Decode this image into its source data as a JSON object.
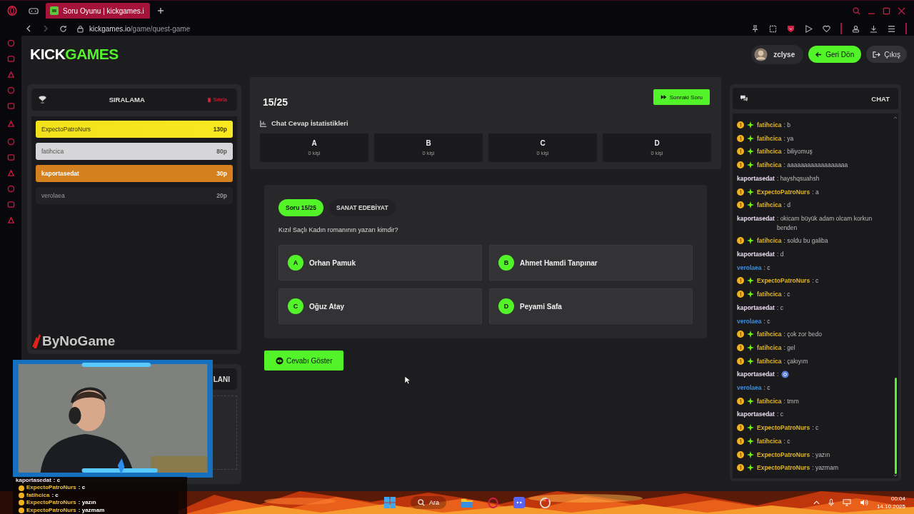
{
  "browser": {
    "tab_title": "Soru Oyunu | kickgames.i",
    "url_host": "kickgames.io",
    "url_path": "/game/quest-game"
  },
  "header": {
    "logo_first": "KICK",
    "logo_second": "GAMES",
    "user": "zclyse",
    "back_button": "Geri Dön",
    "logout_button": "Çıkış"
  },
  "leaderboard": {
    "title": "SIRALAMA",
    "reset": "Sıfırla",
    "rows": [
      {
        "name": "ExpectoPatroNurs",
        "points": "130p",
        "kind": "gold"
      },
      {
        "name": "fatihcica",
        "points": "80p",
        "kind": "silver"
      },
      {
        "name": "kaportasedat",
        "points": "30p",
        "kind": "bronze"
      },
      {
        "name": "verolaea",
        "points": "20p",
        "kind": "plain"
      }
    ]
  },
  "overlay_logo": "ByNoGame",
  "second_panel": {
    "title": "LANI"
  },
  "game": {
    "counter": "15/25",
    "next_button": "Sonraki Soru",
    "stats_title": "Chat Cevap İstatistikleri",
    "stats": [
      {
        "letter": "A",
        "count": "0 kişi"
      },
      {
        "letter": "B",
        "count": "0 kişi"
      },
      {
        "letter": "C",
        "count": "0 kişi"
      },
      {
        "letter": "D",
        "count": "0 kişi"
      }
    ],
    "badge": "Soru 15/25",
    "category": "SANAT EDEBİYAT",
    "question": "Kızıl Saçlı Kadın romanının yazarı kimdir?",
    "options": [
      {
        "letter": "A",
        "text": "Orhan Pamuk"
      },
      {
        "letter": "B",
        "text": "Ahmet Hamdi Tanpınar"
      },
      {
        "letter": "C",
        "text": "Oğuz Atay"
      },
      {
        "letter": "D",
        "text": "Peyami Safa"
      }
    ],
    "reveal_button": "Cevabı Göster"
  },
  "chat": {
    "title": "CHAT",
    "messages": [
      {
        "user": "fatihcica",
        "text": ": b",
        "badges": true,
        "color": "#e3b523",
        "kind": "text"
      },
      {
        "user": "fatihcica",
        "text": ": ya",
        "badges": true,
        "color": "#e3b523",
        "kind": "text"
      },
      {
        "user": "fatihcica",
        "text": ": biliyomuş",
        "badges": true,
        "color": "#e3b523",
        "kind": "text"
      },
      {
        "user": "fatihcica",
        "text": ": aaaaaaaaaaaaaaaaaa",
        "badges": true,
        "color": "#e3b523",
        "kind": "text"
      },
      {
        "user": "kaportasedat",
        "text": ": hayshqsuahsh",
        "badges": false,
        "color": "#eadcf2",
        "kind": "text"
      },
      {
        "user": "ExpectoPatroNurs",
        "text": ": a",
        "badges": true,
        "color": "#e3b523",
        "kind": "text"
      },
      {
        "user": "fatihcica",
        "text": ": d",
        "badges": true,
        "color": "#e3b523",
        "kind": "text"
      },
      {
        "user": "kaportasedat",
        "text": ": okicam büyük adam olcam korkun benden",
        "badges": false,
        "color": "#eadcf2",
        "kind": "text"
      },
      {
        "user": "fatihcica",
        "text": ": soldu bu galiba",
        "badges": true,
        "color": "#e3b523",
        "kind": "text"
      },
      {
        "user": "kaportasedat",
        "text": ": d",
        "badges": false,
        "color": "#eadcf2",
        "kind": "text"
      },
      {
        "user": "verolaea",
        "text": ": c",
        "badges": false,
        "color": "#3b8de0",
        "kind": "text"
      },
      {
        "user": "ExpectoPatroNurs",
        "text": ": c",
        "badges": true,
        "color": "#e3b523",
        "kind": "text"
      },
      {
        "user": "fatihcica",
        "text": ": c",
        "badges": true,
        "color": "#e3b523",
        "kind": "text"
      },
      {
        "user": "kaportasedat",
        "text": ": c",
        "badges": false,
        "color": "#eadcf2",
        "kind": "text"
      },
      {
        "user": "verolaea",
        "text": ": c",
        "badges": false,
        "color": "#3b8de0",
        "kind": "text"
      },
      {
        "user": "fatihcica",
        "text": ": çok zor bedo",
        "badges": true,
        "color": "#e3b523",
        "kind": "text"
      },
      {
        "user": "fatihcica",
        "text": ": gel",
        "badges": true,
        "color": "#e3b523",
        "kind": "text"
      },
      {
        "user": "fatihcica",
        "text": ": çakıyım",
        "badges": true,
        "color": "#e3b523",
        "kind": "text"
      },
      {
        "user": "kaportasedat",
        "text": ":",
        "badges": false,
        "color": "#eadcf2",
        "kind": "emote"
      },
      {
        "user": "verolaea",
        "text": ": c",
        "badges": false,
        "color": "#3b8de0",
        "kind": "text"
      },
      {
        "user": "fatihcica",
        "text": ": tmm",
        "badges": true,
        "color": "#e3b523",
        "kind": "text"
      },
      {
        "user": "kaportasedat",
        "text": ": c",
        "badges": false,
        "color": "#eadcf2",
        "kind": "text"
      },
      {
        "user": "ExpectoPatroNurs",
        "text": ": c",
        "badges": true,
        "color": "#e3b523",
        "kind": "text"
      },
      {
        "user": "fatihcica",
        "text": ": c",
        "badges": true,
        "color": "#e3b523",
        "kind": "text"
      },
      {
        "user": "ExpectoPatroNurs",
        "text": ": yazın",
        "badges": true,
        "color": "#e3b523",
        "kind": "text"
      },
      {
        "user": "ExpectoPatroNurs",
        "text": ": yazmam",
        "badges": true,
        "color": "#e3b523",
        "kind": "text"
      }
    ]
  },
  "stream_chat": [
    {
      "user": "kaportasedat",
      "text": ": c",
      "badges": false
    },
    {
      "user": "ExpectoPatroNurs",
      "text": ": c",
      "badges": true
    },
    {
      "user": "fatihcica",
      "text": ": c",
      "badges": true
    },
    {
      "user": "ExpectoPatroNurs",
      "text": ": yazın",
      "badges": true
    },
    {
      "user": "ExpectoPatroNurs",
      "text": ": yazmam",
      "badges": true
    }
  ],
  "taskbar": {
    "search": "Ara",
    "time": "00:04",
    "date": "14.10.2025"
  }
}
